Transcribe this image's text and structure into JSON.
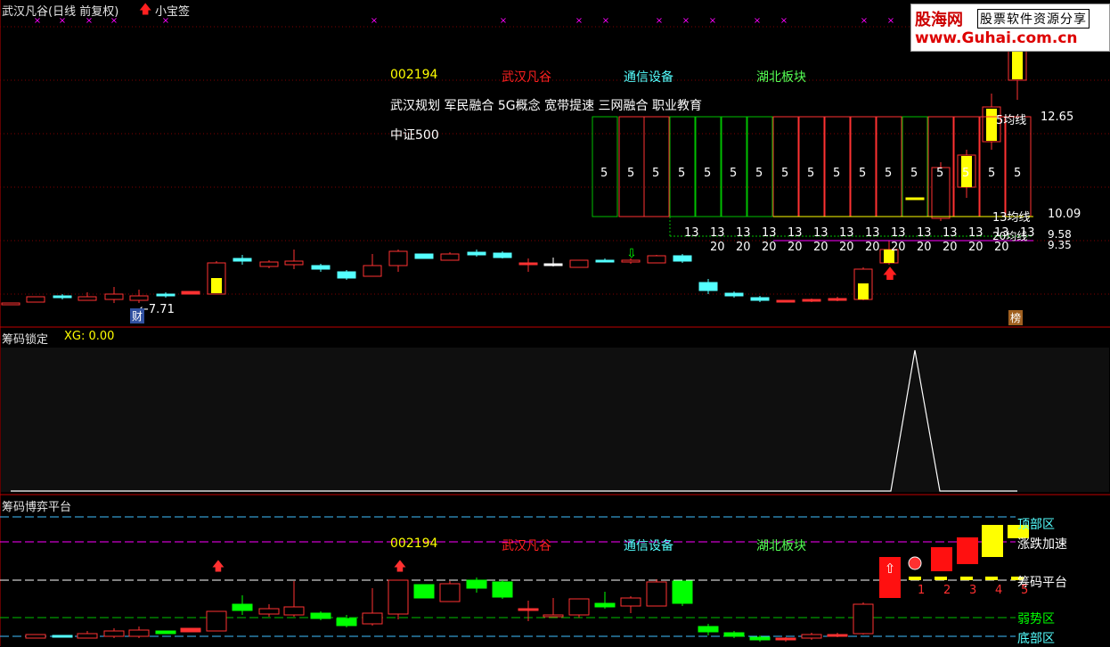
{
  "header": {
    "title": "武汉凡谷(日线 前复权)",
    "tool_label": "小宝签"
  },
  "watermark": {
    "brand": "股海网",
    "slogan": "股票软件资源分享",
    "url": "www.Guhai.com.cn"
  },
  "stock_info": {
    "code": "002194",
    "name": "武汉凡谷",
    "industry": "通信设备",
    "region": "湖北板块",
    "concepts": "武汉规划 军民融合 5G概念 宽带提速 三网融合 职业教育",
    "index": "中证500"
  },
  "main_panel": {
    "low_price_label": "←7.71",
    "finance_badge": "财",
    "rank_badge": "榜",
    "ma5_label": "5均线",
    "ma5_value": "12.65",
    "ma13_label": "13均线",
    "ma13_value": "10.09",
    "ma20_label": "20均线",
    "ma20_value": "9.58",
    "value_b": "9.35",
    "box_counts": [
      "5",
      "5",
      "5",
      "5",
      "5",
      "5",
      "5",
      "5",
      "5",
      "5",
      "5",
      "5",
      "5",
      "5",
      "5",
      "5",
      "5"
    ],
    "row13": [
      "13",
      "13",
      "13",
      "13",
      "13",
      "13",
      "13",
      "13",
      "13",
      "13",
      "13",
      "13",
      "13",
      "13"
    ],
    "row20": [
      "20",
      "20",
      "20",
      "20",
      "20",
      "20",
      "20",
      "20",
      "20",
      "20",
      "20",
      "20"
    ]
  },
  "lock_panel": {
    "title": "筹码锁定",
    "xg_label": "XG: 0.00"
  },
  "game_panel": {
    "title": "筹码博弈平台",
    "zones": {
      "top": "顶部区",
      "accel": "涨跌加速",
      "platform": "筹码平台",
      "weak": "弱势区",
      "bottom": "底部区"
    },
    "step_labels": [
      "1",
      "2",
      "3",
      "4",
      "5"
    ]
  },
  "colors": {
    "up": "#ff3232",
    "down_cyan": "#54ffff",
    "down_green": "#00ff00",
    "yellow": "#ffff00",
    "magenta": "#ff00ff",
    "panel_border": "#c00000",
    "grid": "#800000"
  },
  "chart_data": {
    "type": "candlestick",
    "title": "武汉凡谷(日线 前复权)",
    "last_close_approx": 12.65,
    "low_marked": 7.71,
    "ma_values": {
      "ma5": 12.65,
      "ma13": 10.09,
      "ma20": 9.58,
      "other": 9.35
    },
    "xg": 0.0
  }
}
